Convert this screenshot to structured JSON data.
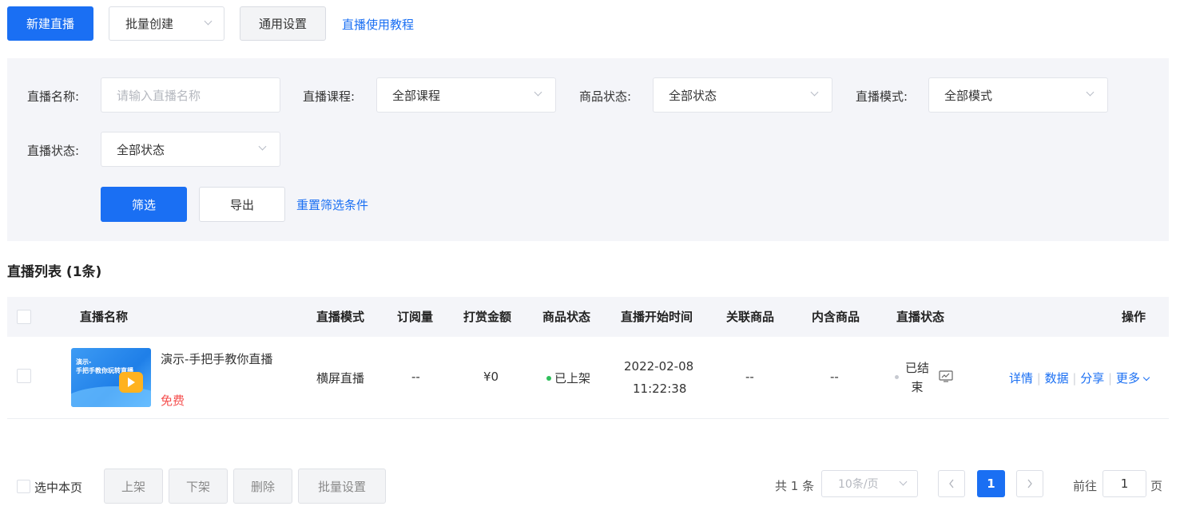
{
  "toolbar": {
    "new_live": "新建直播",
    "batch_create": "批量创建",
    "general_settings": "通用设置",
    "tutorial_link": "直播使用教程"
  },
  "filters": {
    "name_label": "直播名称:",
    "name_placeholder": "请输入直播名称",
    "course_label": "直播课程:",
    "course_value": "全部课程",
    "goods_status_label": "商品状态:",
    "goods_status_value": "全部状态",
    "mode_label": "直播模式:",
    "mode_value": "全部模式",
    "live_status_label": "直播状态:",
    "live_status_value": "全部状态",
    "filter_button": "筛选",
    "export_button": "导出",
    "reset_link": "重置筛选条件"
  },
  "list": {
    "title": "直播列表 (1条)",
    "columns": [
      "直播名称",
      "直播模式",
      "订阅量",
      "打赏金额",
      "商品状态",
      "直播开始时间",
      "关联商品",
      "内含商品",
      "直播状态",
      "操作"
    ],
    "rows": [
      {
        "thumb_text": "演示-\n手把手教你玩转直播",
        "name": "演示-手把手教你直播",
        "price": "免费",
        "mode": "横屏直播",
        "subs": "--",
        "reward": "¥0",
        "goods_status": "已上架",
        "start_date": "2022-02-08",
        "start_time": "11:22:38",
        "related_goods": "--",
        "included_goods": "--",
        "live_status": "已结束",
        "actions": [
          "详情",
          "数据",
          "分享",
          "更多"
        ]
      }
    ]
  },
  "footer": {
    "select_page": "选中本页",
    "shelve": "上架",
    "unshelve": "下架",
    "delete": "删除",
    "batch_settings": "批量设置",
    "total": "共 1 条",
    "page_size": "10条/页",
    "current_page": "1",
    "goto_label": "前往",
    "goto_value": "1",
    "page_suffix": "页"
  },
  "colors": {
    "primary": "#1a6ff3",
    "price_red": "#f5504f",
    "status_green": "#2fbf5b"
  }
}
